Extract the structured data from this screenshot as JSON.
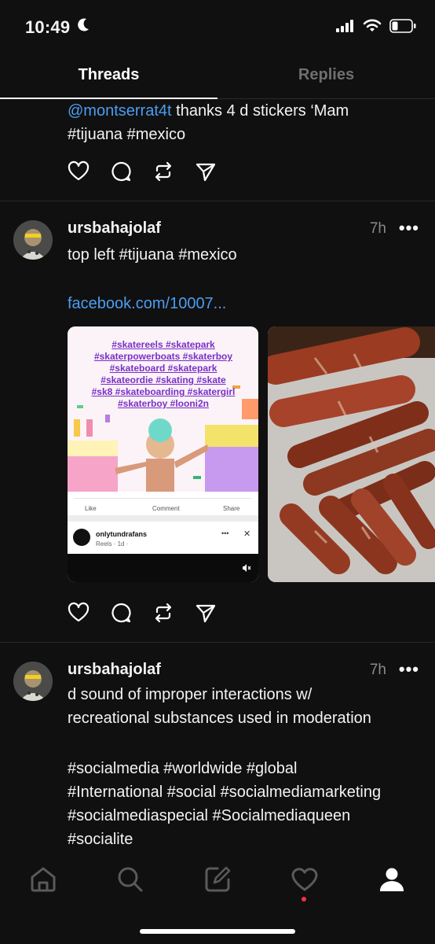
{
  "status_bar": {
    "time": "10:49"
  },
  "tabs": {
    "threads": "Threads",
    "replies": "Replies"
  },
  "post_top": {
    "mention": "@montserrat4t",
    "text": " thanks 4 d stickers ‘Mam",
    "tags": "#tijuana #mexico"
  },
  "post1": {
    "username": "ursbahajolaf",
    "time": "7h",
    "more": "•••",
    "text": "top left #tijuana #mexico",
    "link": "facebook.com/10007...",
    "media1": {
      "hashtags_lines": [
        "#skatereels #skatepark",
        "#skaterpowerboats #skaterboy",
        "#skateboard #skatepark",
        "#skateordie #skating #skate",
        "#sk8 #skateboarding #skatergirl",
        "#skaterboy #looni2n"
      ],
      "like": "Like",
      "comment": "Comment",
      "share": "Share",
      "page_name": "onlytundrafans",
      "reels_meta": "Reels · 1d · ",
      "more": "•••",
      "close": "✕"
    }
  },
  "post2": {
    "username": "ursbahajolaf",
    "time": "7h",
    "more": "•••",
    "line1": "d sound of improper interactions w/",
    "line2": "recreational substances used in moderation",
    "tags1": "#socialmedia #worldwide #global",
    "tags2": "#International #social #socialmediamarketing",
    "tags3": "#socialmediaspecial #Socialmediaqueen",
    "tags4": "#socialite"
  },
  "icons": {
    "moon": "moon-icon",
    "signal": "signal-icon",
    "wifi": "wifi-icon",
    "battery": "battery-icon",
    "like": "heart-icon",
    "comment": "comment-icon",
    "repost": "repost-icon",
    "share": "send-icon",
    "home": "home-icon",
    "search": "search-icon",
    "compose": "compose-icon",
    "activity": "heart-icon",
    "profile": "profile-icon"
  },
  "colors": {
    "background": "#101010",
    "link": "#4a9ef2",
    "muted": "#8a8a8a",
    "notification_dot": "#ff3040"
  }
}
